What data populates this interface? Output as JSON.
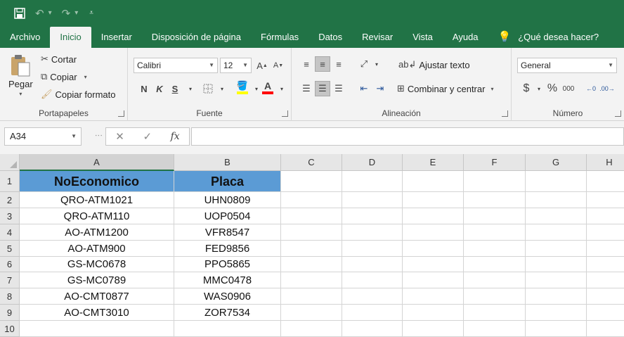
{
  "quick_access": {
    "save": "save-icon",
    "undo": "undo-icon",
    "redo": "redo-icon",
    "customize": "customize-icon"
  },
  "tabs": [
    "Archivo",
    "Inicio",
    "Insertar",
    "Disposición de página",
    "Fórmulas",
    "Datos",
    "Revisar",
    "Vista",
    "Ayuda"
  ],
  "tell_me": "¿Qué desea hacer?",
  "ribbon": {
    "clipboard": {
      "paste": "Pegar",
      "cut": "Cortar",
      "copy": "Copiar",
      "format_painter": "Copiar formato",
      "label": "Portapapeles"
    },
    "font": {
      "name": "Calibri",
      "size": "12",
      "bold": "N",
      "italic": "K",
      "underline": "S",
      "label": "Fuente"
    },
    "alignment": {
      "wrap": "Ajustar texto",
      "merge": "Combinar y centrar",
      "label": "Alineación"
    },
    "number": {
      "format": "General",
      "currency": "$",
      "percent": "%",
      "thousands": "000",
      "label": "Número"
    }
  },
  "formula_bar": {
    "name_box": "A34",
    "cancel": "✕",
    "enter": "✓",
    "fx": "fx",
    "value": ""
  },
  "sheet": {
    "columns": [
      "A",
      "B",
      "C",
      "D",
      "E",
      "F",
      "G",
      "H"
    ],
    "rows": [
      "1",
      "2",
      "3",
      "4",
      "5",
      "6",
      "7",
      "8",
      "9",
      "10"
    ],
    "headers": [
      "NoEconomico",
      "Placa"
    ],
    "data": [
      [
        "QRO-ATM1021",
        "UHN0809"
      ],
      [
        "QRO-ATM110",
        "UOP0504"
      ],
      [
        "AO-ATM1200",
        "VFR8547"
      ],
      [
        "AO-ATM900",
        "FED9856"
      ],
      [
        "GS-MC0678",
        "PPO5865"
      ],
      [
        "GS-MC0789",
        "MMC0478"
      ],
      [
        "AO-CMT0877",
        "WAS0906"
      ],
      [
        "AO-CMT3010",
        "ZOR7534"
      ]
    ],
    "header_fill": "#5b9bd5"
  }
}
